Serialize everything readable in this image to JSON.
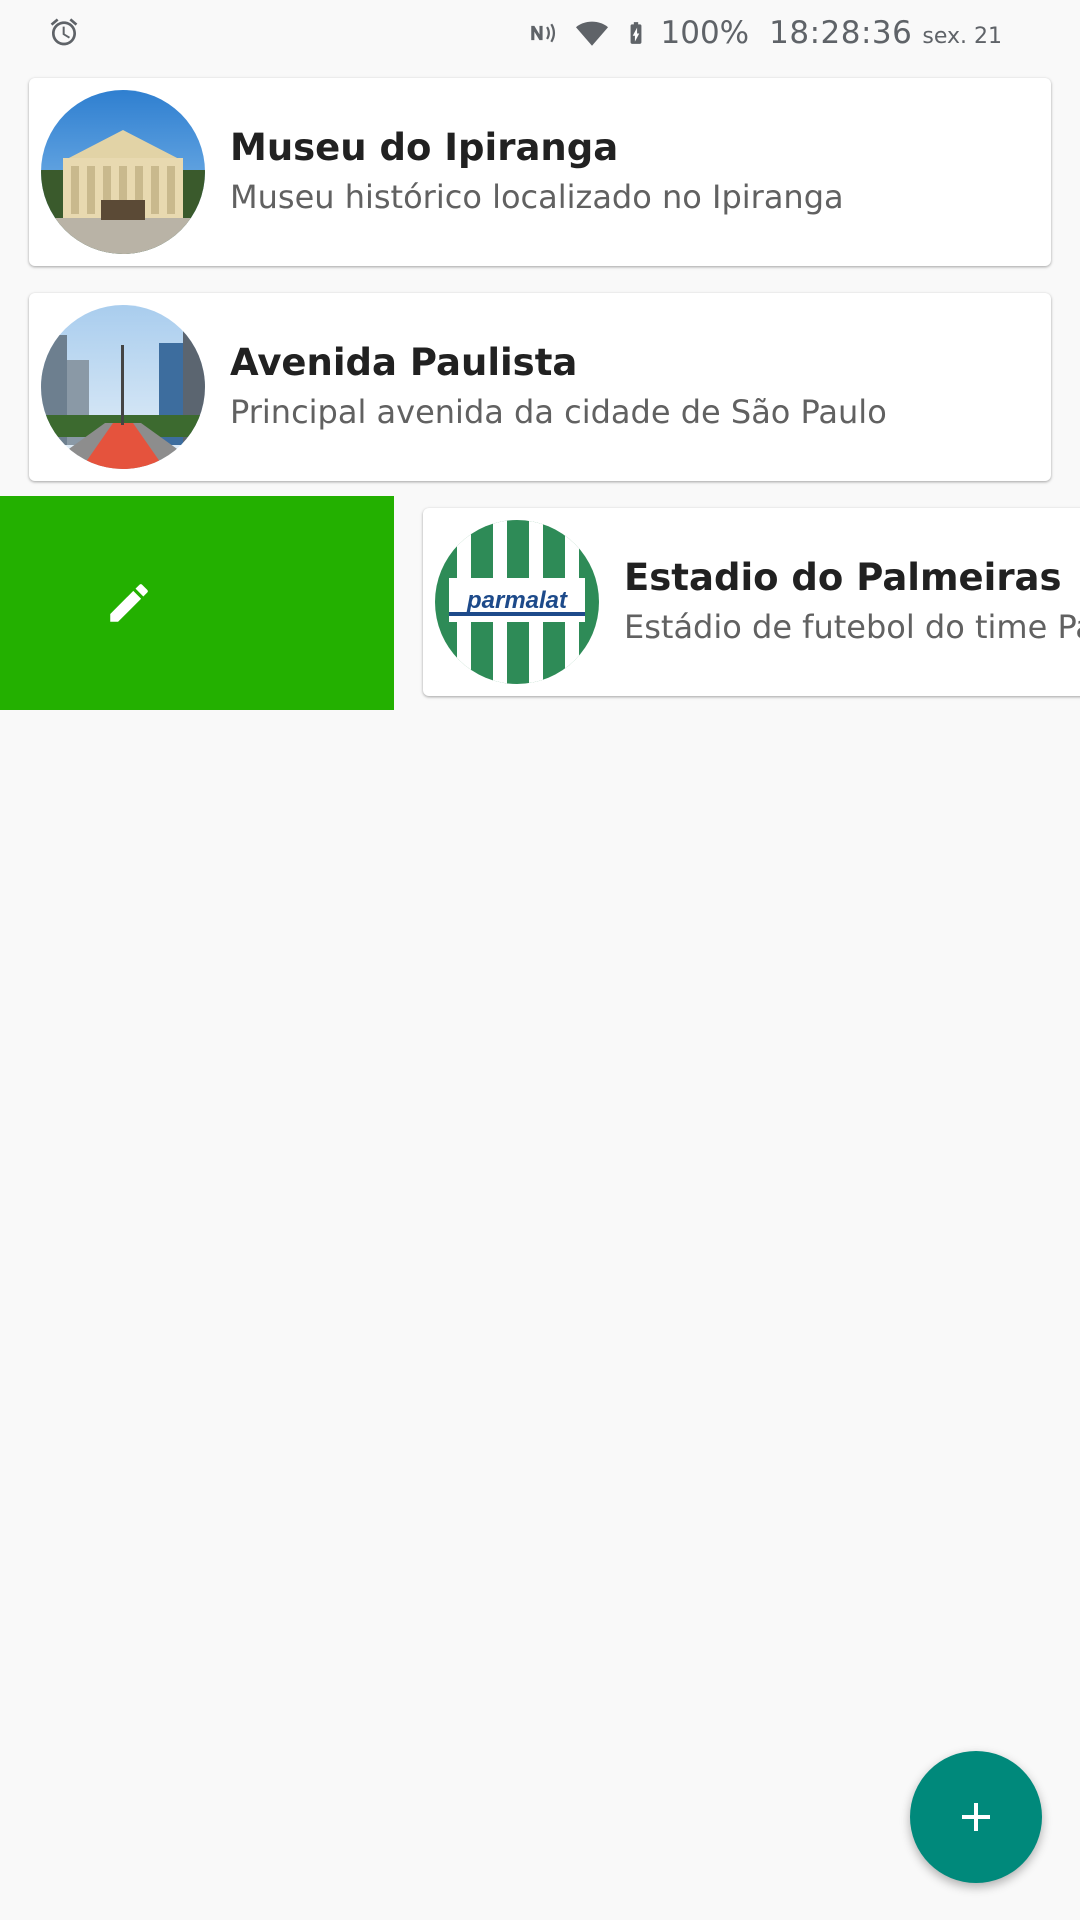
{
  "status_bar": {
    "icons": [
      "alarm-icon",
      "nfc-icon",
      "wifi-icon",
      "battery-charging-icon"
    ],
    "battery": "100%",
    "time": "18:28:36",
    "date": "sex. 21"
  },
  "places": [
    {
      "title": "Museu do Ipiranga",
      "description": "Museu histórico localizado no Ipiranga",
      "image": "museum-photo"
    },
    {
      "title": "Avenida Paulista",
      "description": "Principal avenida da cidade de São Paulo",
      "image": "avenue-photo"
    },
    {
      "title": "Estadio do Palmeiras",
      "description": "Estádio de futebol do time Palmeiras",
      "image": "palmeiras-jersey-photo",
      "swiped": true,
      "logo_text": "parmalat"
    }
  ],
  "swipe_action": {
    "icon": "edit-icon",
    "color": "#23b000"
  },
  "fab": {
    "icon": "add-icon",
    "color": "#00897b"
  }
}
